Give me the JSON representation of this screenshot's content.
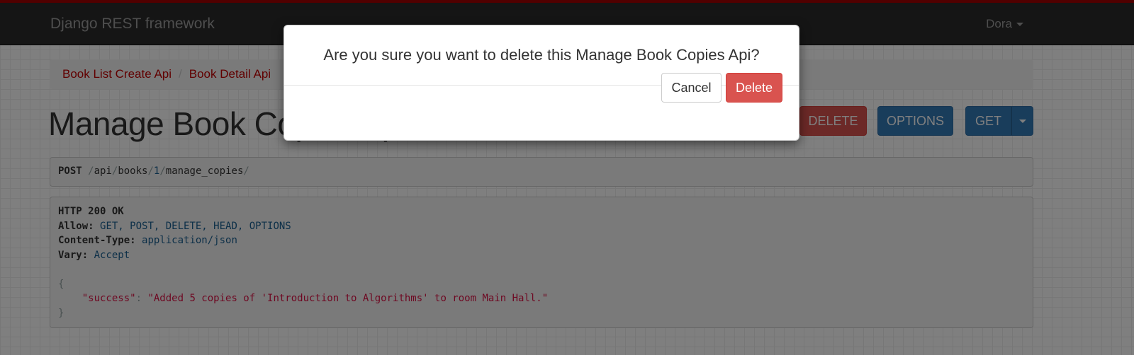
{
  "navbar": {
    "brand": "Django REST framework",
    "user": "Dora"
  },
  "breadcrumb": [
    {
      "label": "Book List Create Api"
    },
    {
      "label": "Book Detail Api"
    }
  ],
  "page": {
    "title": "Manage Book Copies Api"
  },
  "toolbar": {
    "delete_label": "DELETE",
    "options_label": "OPTIONS",
    "get_label": "GET"
  },
  "request": {
    "method": "POST",
    "path_parts": [
      "/",
      "api",
      "/",
      "books",
      "/",
      "1",
      "/",
      "manage_copies",
      "/"
    ]
  },
  "response": {
    "status": "HTTP 200 OK",
    "headers": [
      {
        "name": "Allow:",
        "value": "GET, POST, DELETE, HEAD, OPTIONS"
      },
      {
        "name": "Content-Type:",
        "value": "application/json"
      },
      {
        "name": "Vary:",
        "value": "Accept"
      }
    ],
    "body_open": "{",
    "body_key": "\"success\"",
    "body_colon": ": ",
    "body_value": "\"Added 5 copies of 'Introduction to Algorithms' to room Main Hall.\"",
    "body_close": "}"
  },
  "modal": {
    "title": "Are you sure you want to delete this Manage Book Copies Api?",
    "cancel_label": "Cancel",
    "delete_label": "Delete"
  },
  "colors": {
    "accent": "#a30000",
    "link": "#c20000",
    "danger": "#d9534f",
    "primary": "#337ab7",
    "navbar": "#2b2b2b"
  }
}
